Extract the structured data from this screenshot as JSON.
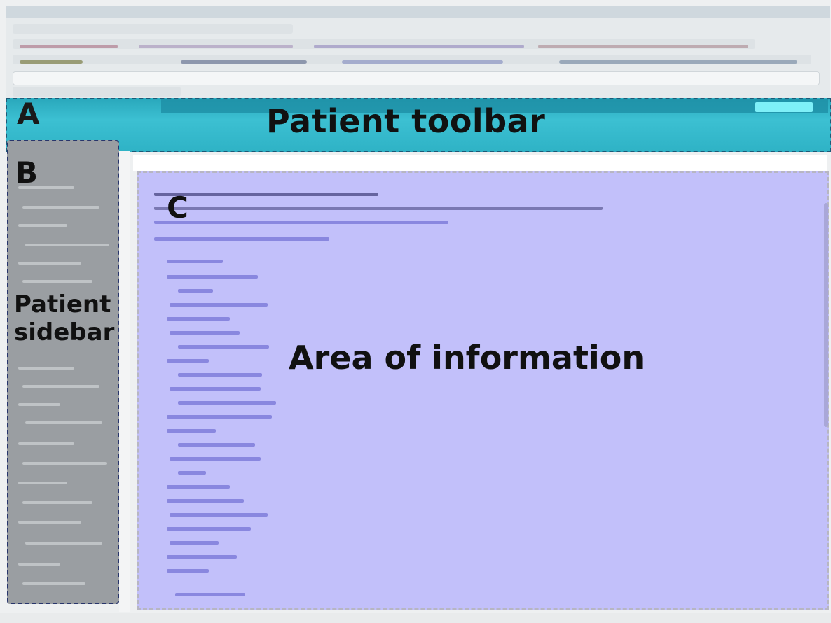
{
  "regions": {
    "toolbar": {
      "letter": "A",
      "label": "Patient toolbar"
    },
    "sidebar": {
      "letter": "B",
      "label_line1": "Patient",
      "label_line2": "sidebar"
    },
    "info": {
      "letter": "C",
      "label": "Area of information"
    }
  },
  "colors": {
    "toolbar": "#2fb3c6",
    "sidebar": "#9a9ea2",
    "info": "#c2c0fa",
    "label_text": "#111111"
  }
}
